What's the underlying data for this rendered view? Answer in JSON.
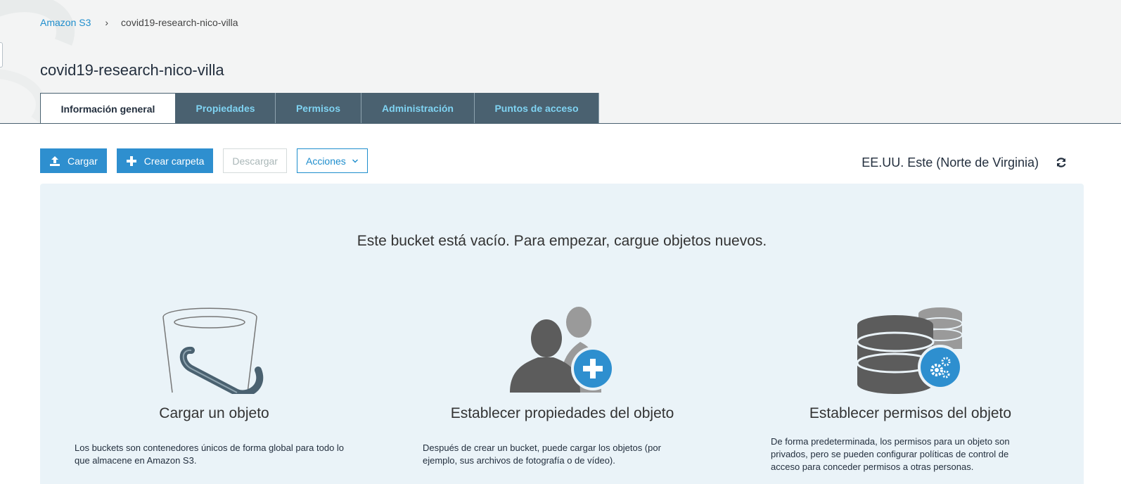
{
  "breadcrumb": {
    "root": "Amazon S3",
    "separator": "›",
    "current": "covid19-research-nico-villa"
  },
  "page": {
    "title": "covid19-research-nico-villa"
  },
  "tabs": [
    {
      "label": "Información general",
      "active": true
    },
    {
      "label": "Propiedades",
      "active": false
    },
    {
      "label": "Permisos",
      "active": false
    },
    {
      "label": "Administración",
      "active": false
    },
    {
      "label": "Puntos de acceso",
      "active": false
    }
  ],
  "toolbar": {
    "upload_label": "Cargar",
    "create_folder_label": "Crear carpeta",
    "download_label": "Descargar",
    "actions_label": "Acciones"
  },
  "region": {
    "label": "EE.UU. Este (Norte de Virginia)"
  },
  "empty_state": {
    "title": "Este bucket está vacío. Para empezar, cargue objetos nuevos.",
    "columns": [
      {
        "icon": "bucket-icon",
        "title": "Cargar un objeto",
        "description": "Los buckets son contenedores únicos de forma global para todo lo que almacene en Amazon S3."
      },
      {
        "icon": "users-add-icon",
        "title": "Establecer propiedades del objeto",
        "description": "Después de crear un bucket, puede cargar los objetos (por ejemplo, sus archivos de fotografía o de vídeo)."
      },
      {
        "icon": "database-gear-icon",
        "title": "Establecer permisos del objeto",
        "description": "De forma predeterminada, los permisos para un objeto son privados, pero se pueden configurar políticas de control de acceso para conceder permisos a otras personas."
      }
    ]
  },
  "colors": {
    "accent": "#2e8fcf",
    "tab_bg": "#4a6170",
    "tab_text": "#7fd3f2",
    "panel_bg": "#eaf3f8"
  }
}
